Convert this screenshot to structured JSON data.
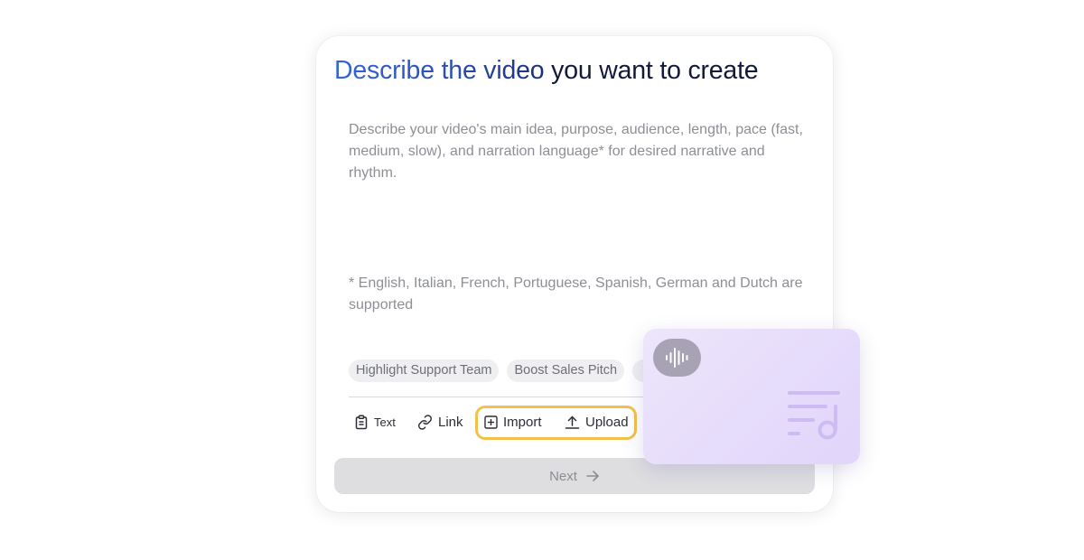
{
  "title": {
    "highlight": "Describe the video",
    "rest": " you want to create"
  },
  "prompt_placeholder": "Describe your video's main idea, purpose, audience, length, pace (fast, medium, slow), and narration language* for desired narrative and rhythm.",
  "languages_note": "* English, Italian, French, Portuguese, Spanish, German and Dutch are supported",
  "suggestions": [
    "Highlight Support Team",
    "Boost Sales Pitch"
  ],
  "toolbar": {
    "text_label": "Text",
    "link_label": "Link",
    "import_label": "Import",
    "upload_label": "Upload"
  },
  "next_label": "Next",
  "icons": {
    "text": "clipboard-icon",
    "link": "link-icon",
    "import": "plus-square-icon",
    "upload": "upload-icon",
    "next": "arrow-right-icon",
    "audio": "sound-wave-icon",
    "music": "playlist-music-icon"
  },
  "colors": {
    "title_accent": "#3566d6",
    "highlight_border": "#f2c14a",
    "audio_card": "#e6dcfb"
  }
}
